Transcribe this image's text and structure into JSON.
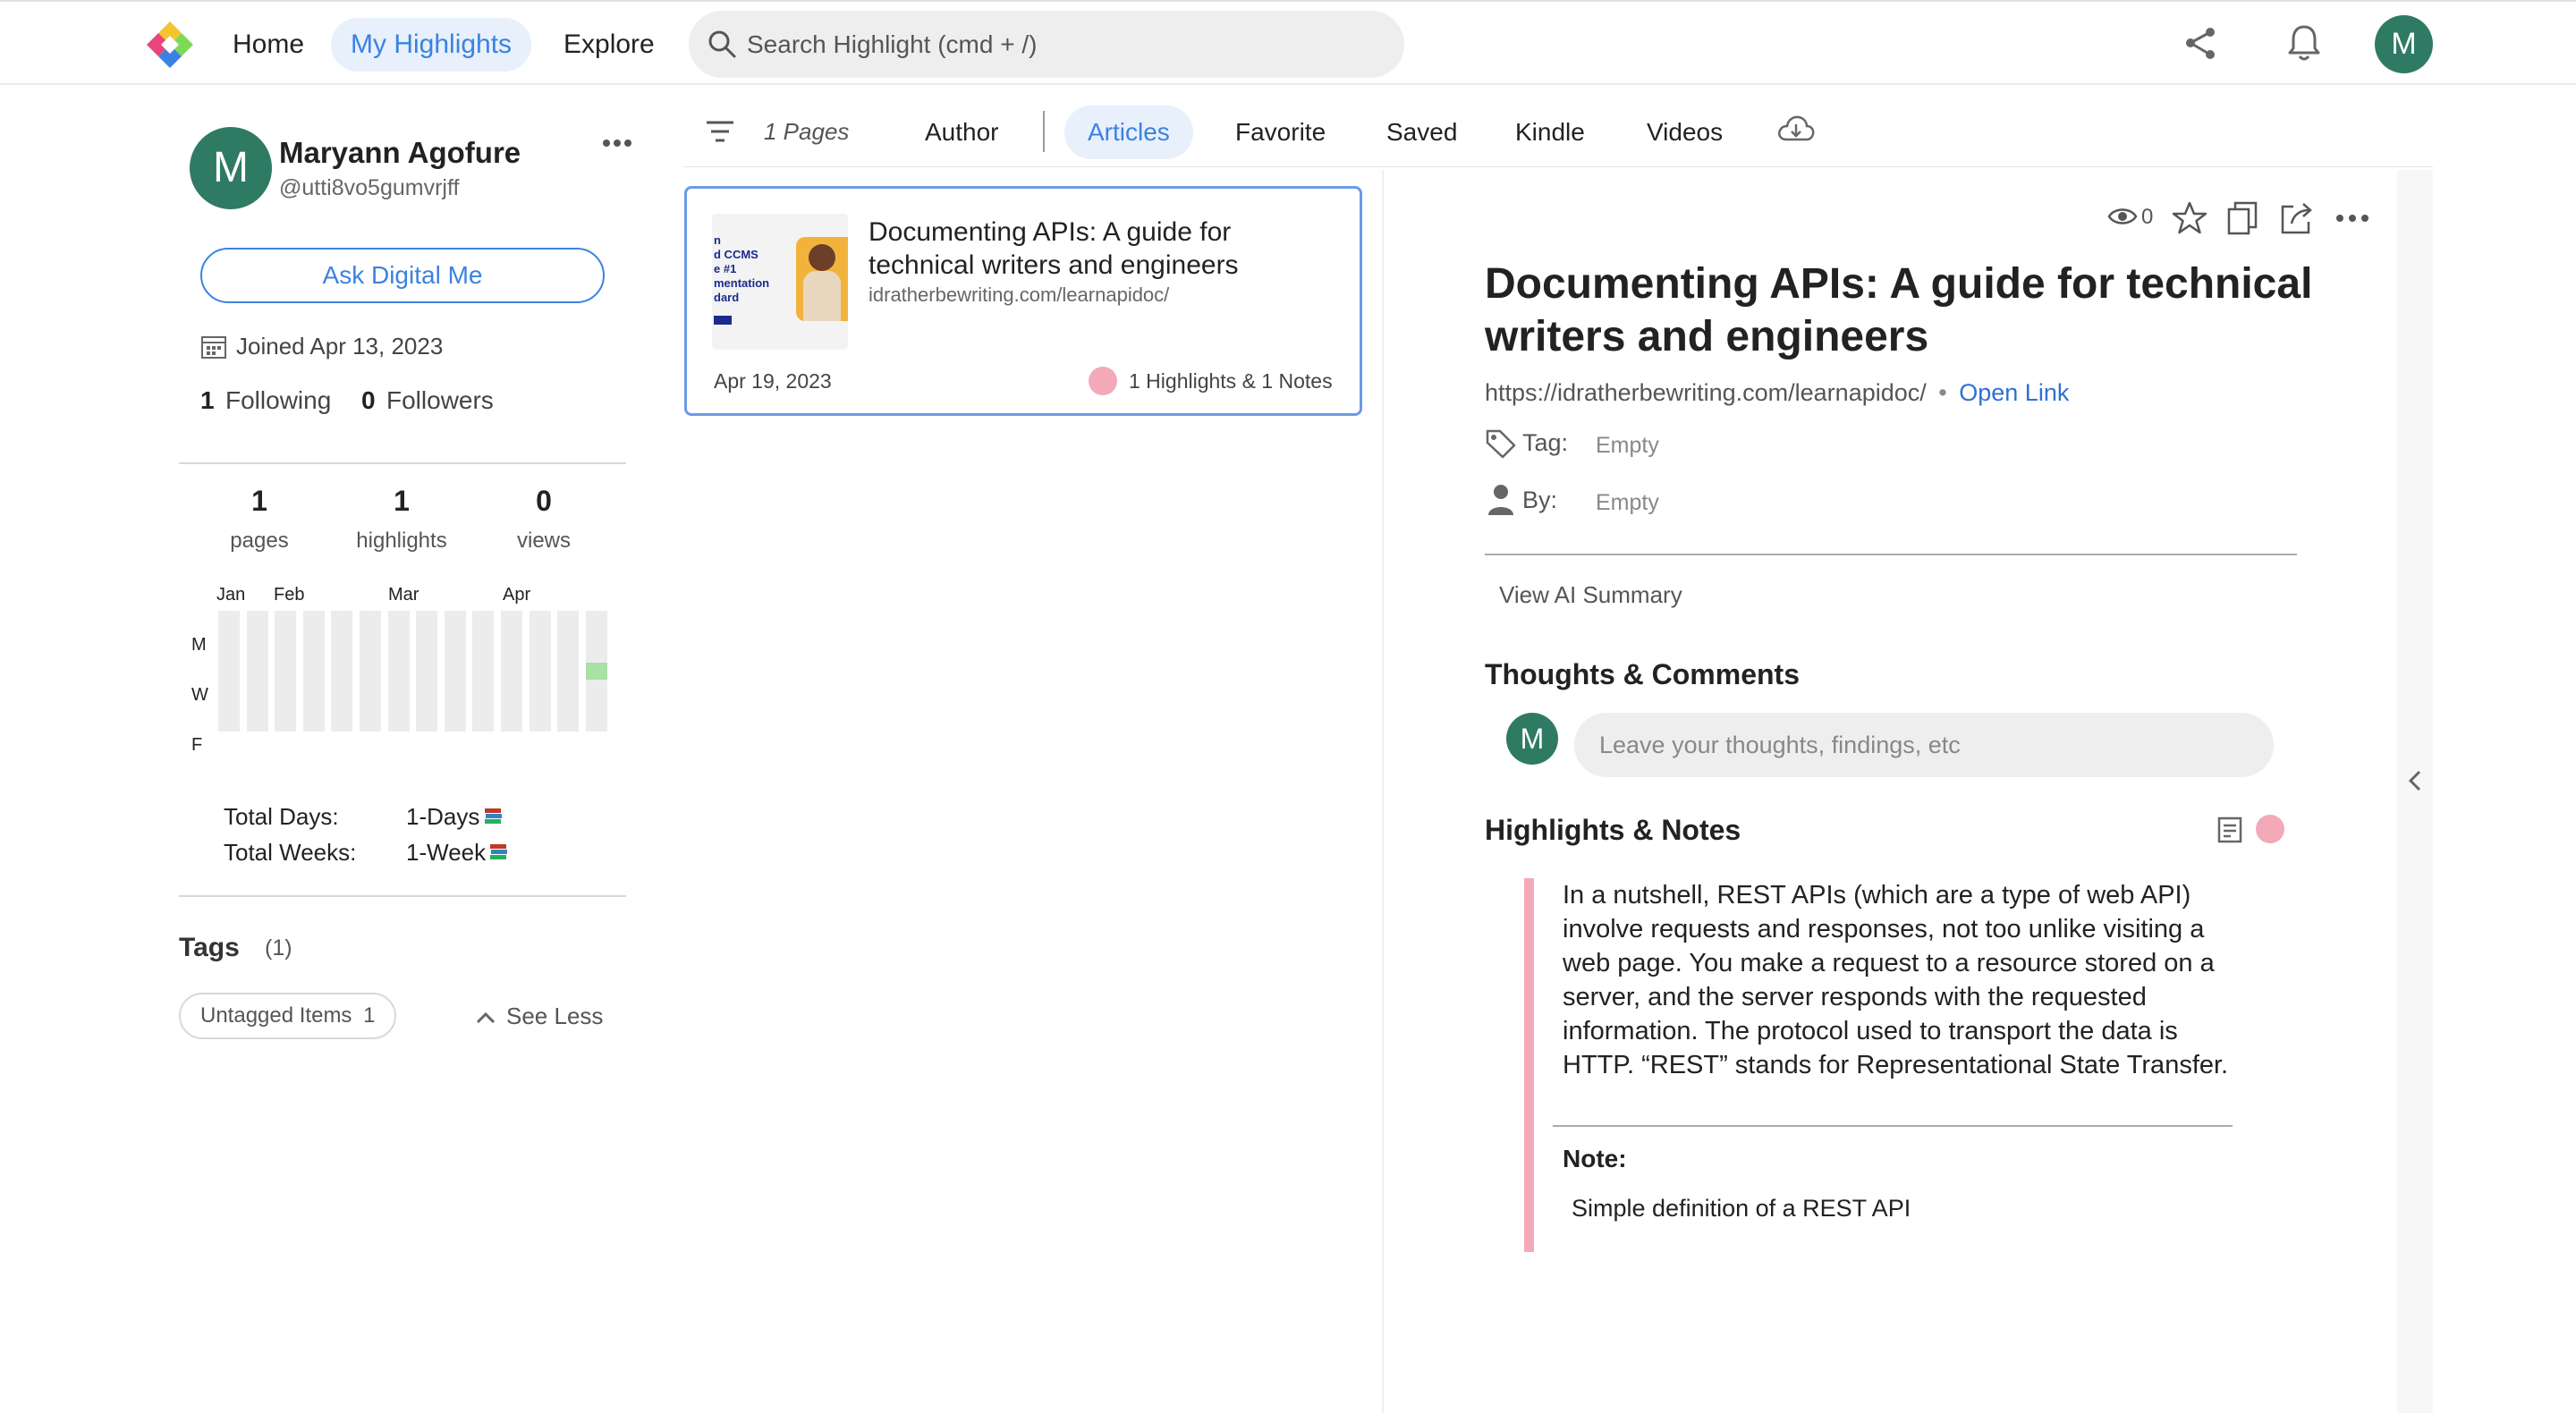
{
  "nav": {
    "home": "Home",
    "my_highlights": "My Highlights",
    "explore": "Explore",
    "search_placeholder": "Search Highlight (cmd + /)",
    "avatar_initial": "M"
  },
  "profile": {
    "avatar_initial": "M",
    "name": "Maryann Agofure",
    "handle": "@utti8vo5gumvrjff",
    "ask_button": "Ask Digital Me",
    "joined": "Joined Apr 13, 2023",
    "following_count": "1",
    "following_label": "Following",
    "followers_count": "0",
    "followers_label": "Followers"
  },
  "stats": [
    {
      "value": "1",
      "label": "pages"
    },
    {
      "value": "1",
      "label": "highlights"
    },
    {
      "value": "0",
      "label": "views"
    }
  ],
  "calendar": {
    "months": [
      "Jan",
      "Feb",
      "Mar",
      "Apr"
    ],
    "day_labels": [
      "M",
      "W",
      "F"
    ],
    "total_days_label": "Total Days:",
    "total_days_value": "1-Days",
    "total_weeks_label": "Total Weeks:",
    "total_weeks_value": "1-Week",
    "colors": {
      "empty": "#ececec",
      "active": "#a9e0a4"
    }
  },
  "tags": {
    "title": "Tags",
    "count": "(1)",
    "chip_label": "Untagged Items",
    "chip_count": "1",
    "see_less": "See Less"
  },
  "tabs": {
    "pages_count": "1 Pages",
    "items": [
      "Author",
      "Articles",
      "Favorite",
      "Saved",
      "Kindle",
      "Videos"
    ],
    "active": "Articles"
  },
  "card": {
    "title": "Documenting APIs: A guide for technical writers and engineers",
    "url": "idratherbewriting.com/learnapidoc/",
    "date": "Apr 19, 2023",
    "summary": "1 Highlights & 1 Notes",
    "thumb_text": [
      "n",
      "d CCMS",
      "e #1",
      "mentation",
      "dard"
    ]
  },
  "detail": {
    "views": "0",
    "title": "Documenting APIs: A guide for technical writers and engineers",
    "url": "https://idratherbewriting.com/learnapidoc/",
    "separator": "•",
    "open_link": "Open Link",
    "tag_label": "Tag:",
    "tag_value": "Empty",
    "by_label": "By:",
    "by_value": "Empty",
    "ai_summary": "View AI Summary",
    "thoughts_title": "Thoughts & Comments",
    "comment_avatar": "M",
    "comment_placeholder": "Leave your thoughts, findings, etc",
    "highlights_title": "Highlights & Notes",
    "highlight_text": "In a nutshell, REST APIs (which are a type of web API) involve requests and responses, not too unlike visiting a web page. You make a request to a resource stored on a server, and the server responds with the requested information. The protocol used to transport the data is HTTP. “REST” stands for Representational State Transfer.",
    "note_label": "Note:",
    "note_text": "Simple definition of a REST API",
    "accent_pink": "#f4a9b8",
    "link_blue": "#2f6fd6"
  }
}
